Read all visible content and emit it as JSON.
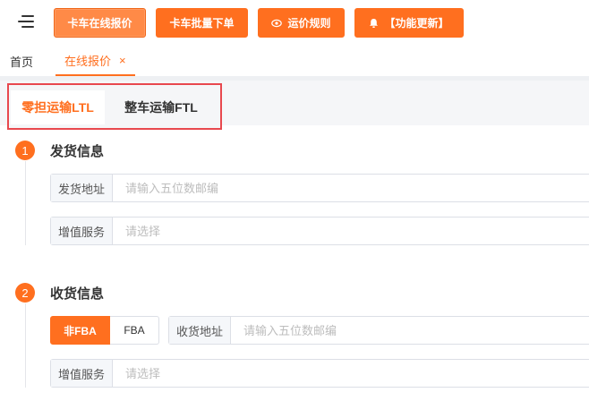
{
  "toolbar": {
    "buttons": [
      {
        "label": "卡车在线报价",
        "icon": "",
        "active": true
      },
      {
        "label": "卡车批量下单",
        "icon": "",
        "active": false
      },
      {
        "label": "运价规则",
        "icon": "eye-icon",
        "active": false
      },
      {
        "label": "【功能更新】",
        "icon": "bell-icon",
        "active": false
      }
    ]
  },
  "nav": {
    "home_label": "首页",
    "current_label": "在线报价",
    "close_glyph": "×"
  },
  "mode_tabs": {
    "ltl_label": "零担运输LTL",
    "ftl_label": "整车运输FTL",
    "selected": "ltl"
  },
  "sender": {
    "step_number": "1",
    "title": "发货信息",
    "address_label": "发货地址",
    "address_placeholder": "请输入五位数邮编",
    "service_label": "增值服务",
    "service_placeholder": "请选择"
  },
  "receiver": {
    "step_number": "2",
    "title": "收货信息",
    "type_options": [
      "非FBA",
      "FBA"
    ],
    "type_selected": "非FBA",
    "address_label": "收货地址",
    "address_placeholder": "请输入五位数邮编",
    "service_label": "增值服务",
    "service_placeholder": "请选择"
  },
  "colors": {
    "accent": "#ff6f1f",
    "highlight_border": "#e8484e"
  }
}
